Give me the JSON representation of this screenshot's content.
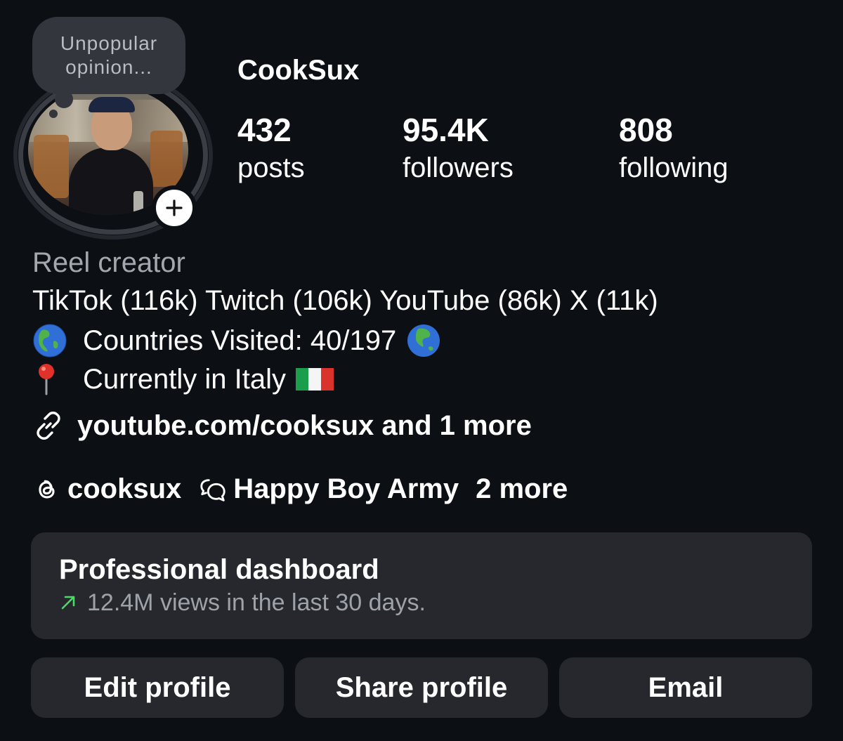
{
  "note": {
    "text": "Unpopular opinion..."
  },
  "profile": {
    "username": "CookSux",
    "stats": [
      {
        "value": "432",
        "label": "posts"
      },
      {
        "value": "95.4K",
        "label": "followers"
      },
      {
        "value": "808",
        "label": "following"
      }
    ]
  },
  "bio": {
    "category": "Reel creator",
    "line1": "TikTok (116k) Twitch (106k) YouTube (86k) X (11k)",
    "line2": "Countries Visited: 40/197",
    "line3": "Currently in Italy",
    "icons": [
      "globe-americas-emoji",
      "globe-asia-emoji",
      "round-pushpin-emoji",
      "italy-flag-emoji"
    ]
  },
  "link": {
    "text": "youtube.com/cooksux and 1 more",
    "icon": "link-icon"
  },
  "social": {
    "threads": "cooksux",
    "channel": "Happy Boy Army",
    "more": "2 more"
  },
  "dashboard": {
    "title": "Professional dashboard",
    "subtitle": "12.4M views in the last 30 days.",
    "trend_color": "#4cd964"
  },
  "buttons": {
    "edit": "Edit profile",
    "share": "Share profile",
    "email": "Email"
  },
  "colors": {
    "background": "#0c0f14",
    "card": "#26282e",
    "muted": "#a3a7ae"
  }
}
